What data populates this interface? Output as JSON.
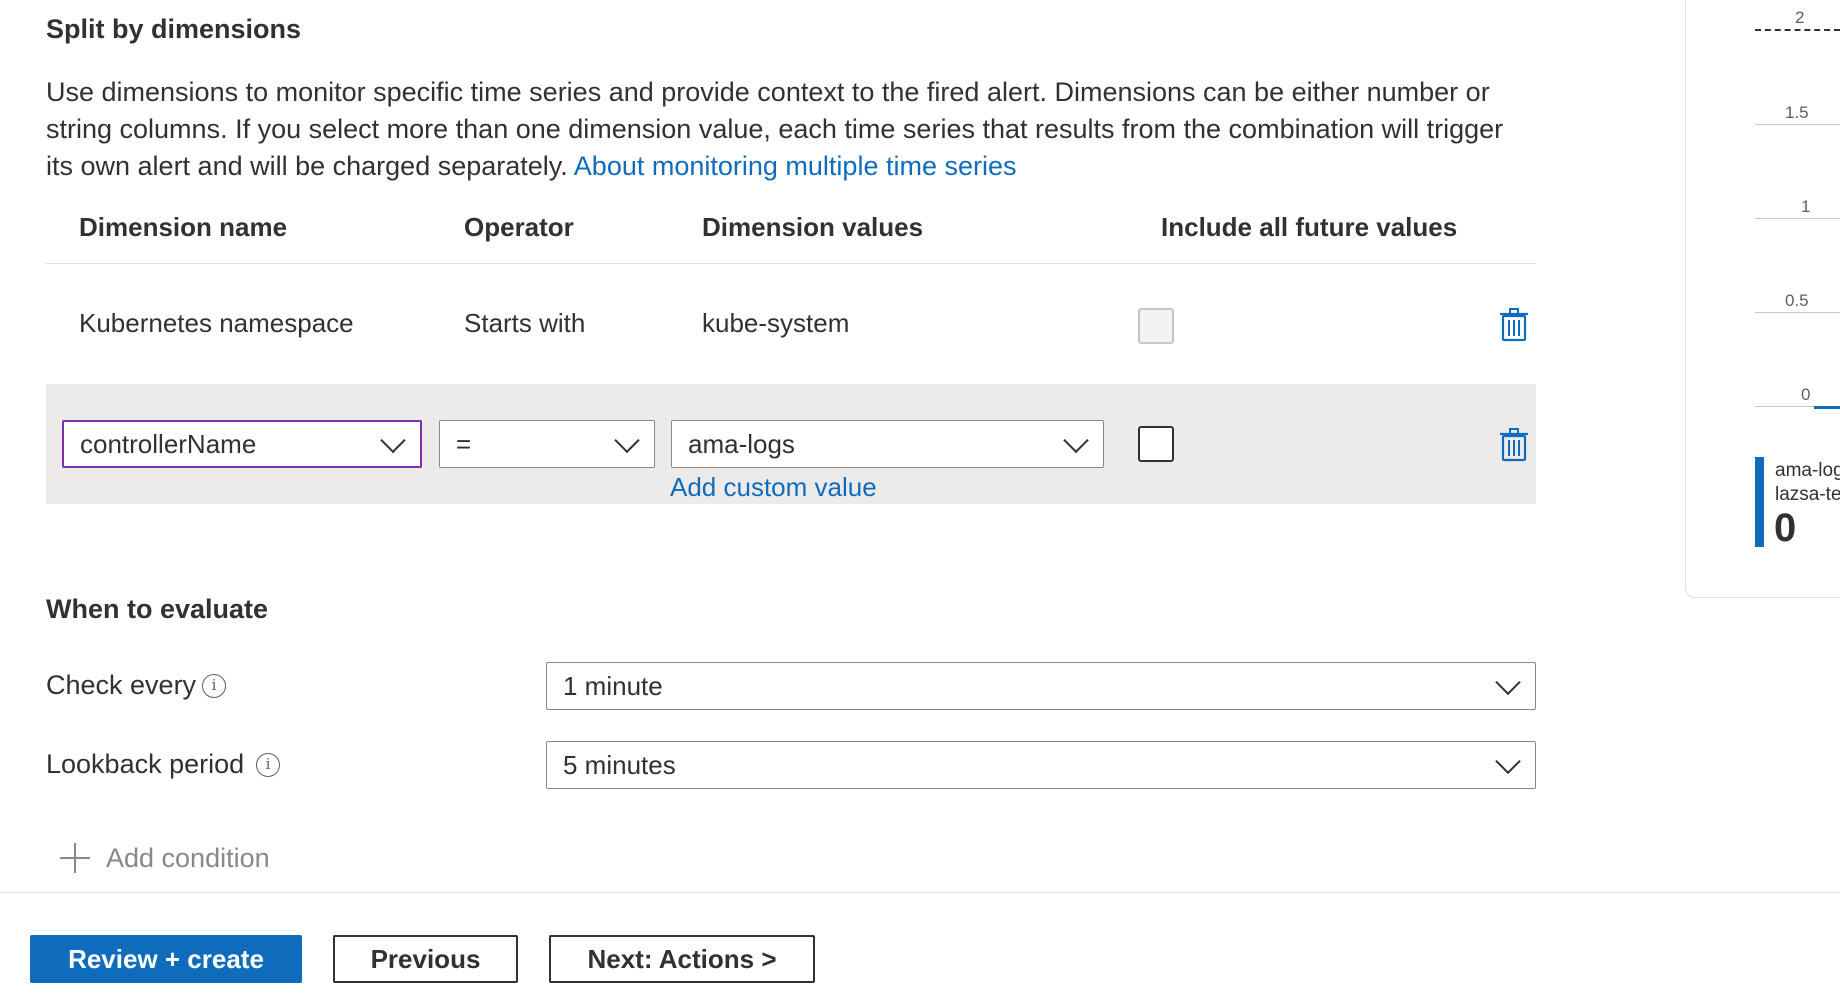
{
  "split_section": {
    "title": "Split by dimensions",
    "description": "Use dimensions to monitor specific time series and provide context to the fired alert. Dimensions can be either number or string columns. If you select more than one dimension value, each time series that results from the combination will trigger its own alert and will be charged separately. ",
    "link_text": "About monitoring multiple time series"
  },
  "dimension_table": {
    "headers": [
      "Dimension name",
      "Operator",
      "Dimension values",
      "Include all future values"
    ],
    "rows": [
      {
        "name": "Kubernetes namespace",
        "operator": "Starts with",
        "values": "kube-system",
        "include_future": false
      },
      {
        "name": "controllerName",
        "operator": "=",
        "values": "ama-logs",
        "include_future": false
      }
    ],
    "add_custom_value": "Add custom value"
  },
  "evaluate_section": {
    "title": "When to evaluate",
    "check_every_label": "Check every",
    "check_every_value": "1 minute",
    "lookback_label": "Lookback period",
    "lookback_value": "5 minutes",
    "info_glyph": "i"
  },
  "add_condition": "Add condition",
  "footer": {
    "review_create": "Review + create",
    "previous": "Previous",
    "next_actions": "Next: Actions >"
  },
  "chart_panel": {
    "y_ticks": [
      "2",
      "1.5",
      "1",
      "0.5",
      "0"
    ],
    "legend_name": "ama-log",
    "legend_sub": "lazsa-tec",
    "legend_value": "0",
    "series_color": "#0f6cbd"
  },
  "colors": {
    "accent": "#0f6cbd",
    "focus_border": "#7b2fa8",
    "edit_row_bg": "#edebe9"
  }
}
